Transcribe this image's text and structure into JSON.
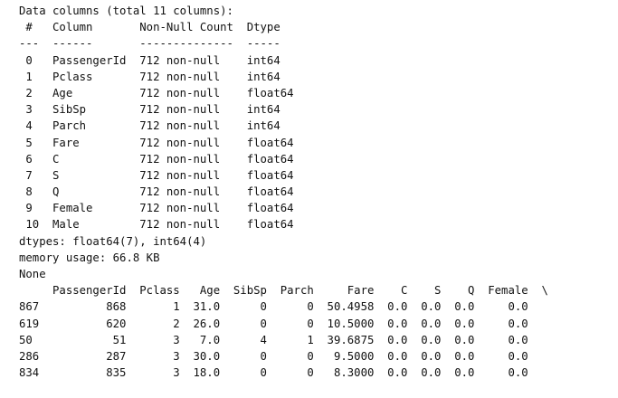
{
  "output": {
    "header": "Data columns (total 11 columns):",
    "info_table": {
      "header": " #   Column       Non-Null Count  Dtype",
      "separator": "---  ------       --------------  -----",
      "rows": [
        " 0   PassengerId  712 non-null    int64",
        " 1   Pclass       712 non-null    int64",
        " 2   Age          712 non-null    float64",
        " 3   SibSp        712 non-null    int64",
        " 4   Parch        712 non-null    int64",
        " 5   Fare         712 non-null    float64",
        " 6   C            712 non-null    float64",
        " 7   S            712 non-null    float64",
        " 8   Q            712 non-null    float64",
        " 9   Female       712 non-null    float64",
        " 10  Male         712 non-null    float64"
      ]
    },
    "dtypes": "dtypes: float64(7), int64(4)",
    "memory": "memory usage: 66.8 KB",
    "none": "None",
    "head_table": {
      "header": "     PassengerId  Pclass   Age  SibSp  Parch     Fare    C    S    Q  Female  \\",
      "rows": [
        "867          868       1  31.0      0      0  50.4958  0.0  0.0  0.0     0.0",
        "619          620       2  26.0      0      0  10.5000  0.0  0.0  0.0     0.0",
        "50            51       3   7.0      4      1  39.6875  0.0  0.0  0.0     0.0",
        "286          287       3  30.0      0      0   9.5000  0.0  0.0  0.0     0.0",
        "834          835       3  18.0      0      0   8.3000  0.0  0.0  0.0     0.0"
      ]
    }
  }
}
